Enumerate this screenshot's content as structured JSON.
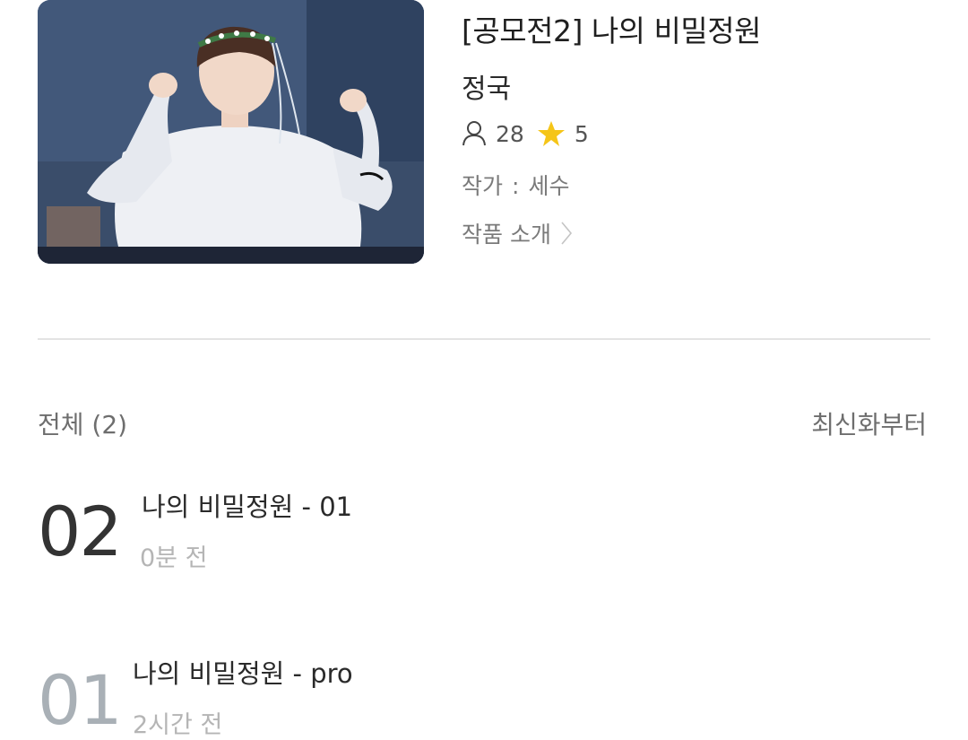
{
  "work": {
    "title": "[공모전2] 나의 비밀정원",
    "subject": "정국",
    "readers": "28",
    "stars": "5",
    "author_label": "작가",
    "author_sep": ":",
    "author_name": "세수",
    "intro_label": "작품 소개",
    "cover_icon": "cover-image"
  },
  "episodes": {
    "total_label": "전체 (2)",
    "sort_label": "최신화부터",
    "items": [
      {
        "number": "02",
        "title": "나의 비밀정원 - 01",
        "time": "0분 전"
      },
      {
        "number": "01",
        "title": "나의 비밀정원 - pro",
        "time": "2시간 전"
      }
    ]
  },
  "colors": {
    "star": "#f5c518",
    "divider": "#e3e3e3",
    "muted_number": "#a9b0b6"
  }
}
